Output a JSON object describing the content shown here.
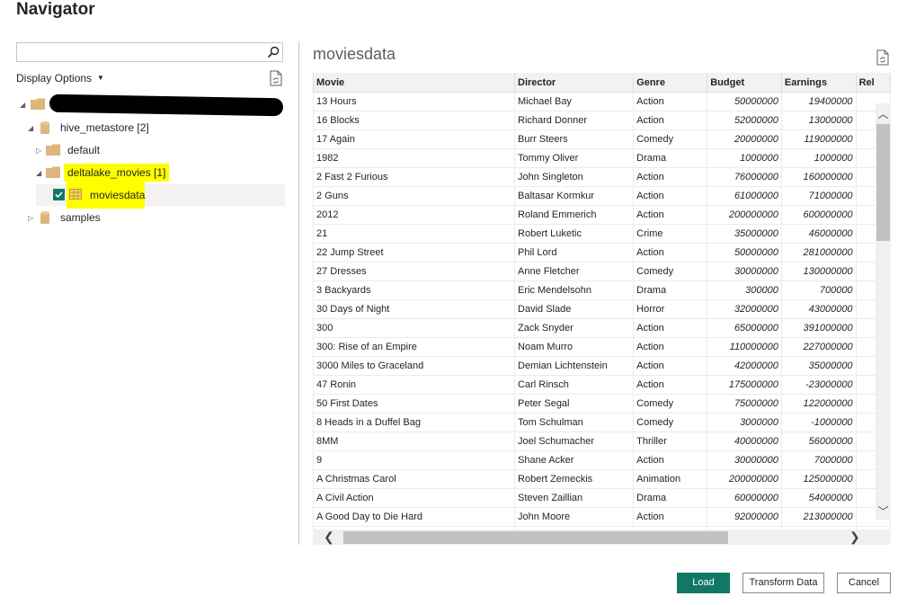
{
  "window": {
    "title": "Navigator"
  },
  "search": {
    "value": "",
    "placeholder": ""
  },
  "display_options": {
    "label": "Display Options"
  },
  "tree": {
    "hive_metastore": "hive_metastore [2]",
    "default": "default",
    "deltalake_movies": "deltalake_movies [1]",
    "moviesdata": "moviesdata",
    "samples": "samples"
  },
  "preview": {
    "title": "moviesdata",
    "columns": [
      "Movie",
      "Director",
      "Genre",
      "Budget",
      "Earnings",
      "Rel"
    ],
    "rows": [
      [
        "13 Hours",
        "Michael Bay",
        "Action",
        "50000000",
        "19400000"
      ],
      [
        "16 Blocks",
        "Richard Donner",
        "Action",
        "52000000",
        "13000000"
      ],
      [
        "17 Again",
        "Burr Steers",
        "Comedy",
        "20000000",
        "119000000"
      ],
      [
        "1982",
        "Tommy Oliver",
        "Drama",
        "1000000",
        "1000000"
      ],
      [
        "2 Fast 2 Furious",
        "John Singleton",
        "Action",
        "76000000",
        "160000000"
      ],
      [
        "2 Guns",
        "Baltasar Kormkur",
        "Action",
        "61000000",
        "71000000"
      ],
      [
        "2012",
        "Roland Emmerich",
        "Action",
        "200000000",
        "600000000"
      ],
      [
        "21",
        "Robert Luketic",
        "Crime",
        "35000000",
        "46000000"
      ],
      [
        "22 Jump Street",
        "Phil Lord",
        "Action",
        "50000000",
        "281000000"
      ],
      [
        "27 Dresses",
        "Anne Fletcher",
        "Comedy",
        "30000000",
        "130000000"
      ],
      [
        "3 Backyards",
        "Eric Mendelsohn",
        "Drama",
        "300000",
        "700000"
      ],
      [
        "30 Days of Night",
        "David Slade",
        "Horror",
        "32000000",
        "43000000"
      ],
      [
        "300",
        "Zack Snyder",
        "Action",
        "65000000",
        "391000000"
      ],
      [
        "300: Rise of an Empire",
        "Noam Murro",
        "Action",
        "110000000",
        "227000000"
      ],
      [
        "3000 Miles to Graceland",
        "Demian Lichtenstein",
        "Action",
        "42000000",
        "35000000"
      ],
      [
        "47 Ronin",
        "Carl Rinsch",
        "Action",
        "175000000",
        "-23000000"
      ],
      [
        "50 First Dates",
        "Peter Segal",
        "Comedy",
        "75000000",
        "122000000"
      ],
      [
        "8 Heads in a Duffel Bag",
        "Tom Schulman",
        "Comedy",
        "3000000",
        "-1000000"
      ],
      [
        "8MM",
        "Joel Schumacher",
        "Thriller",
        "40000000",
        "56000000"
      ],
      [
        "9",
        "Shane Acker",
        "Action",
        "30000000",
        "7000000"
      ],
      [
        "A Christmas Carol",
        "Robert Zemeckis",
        "Animation",
        "200000000",
        "125000000"
      ],
      [
        "A Civil Action",
        "Steven Zaillian",
        "Drama",
        "60000000",
        "54000000"
      ],
      [
        "A Good Day to Die Hard",
        "John Moore",
        "Action",
        "92000000",
        "213000000"
      ],
      [
        "",
        "",
        "",
        "",
        ""
      ]
    ]
  },
  "buttons": {
    "load": "Load",
    "transform": "Transform Data",
    "cancel": "Cancel"
  },
  "colors": {
    "accent": "#117865",
    "highlight": "#ffff00",
    "folder": "#dcb67a",
    "table_icon": "#e8b82b"
  }
}
